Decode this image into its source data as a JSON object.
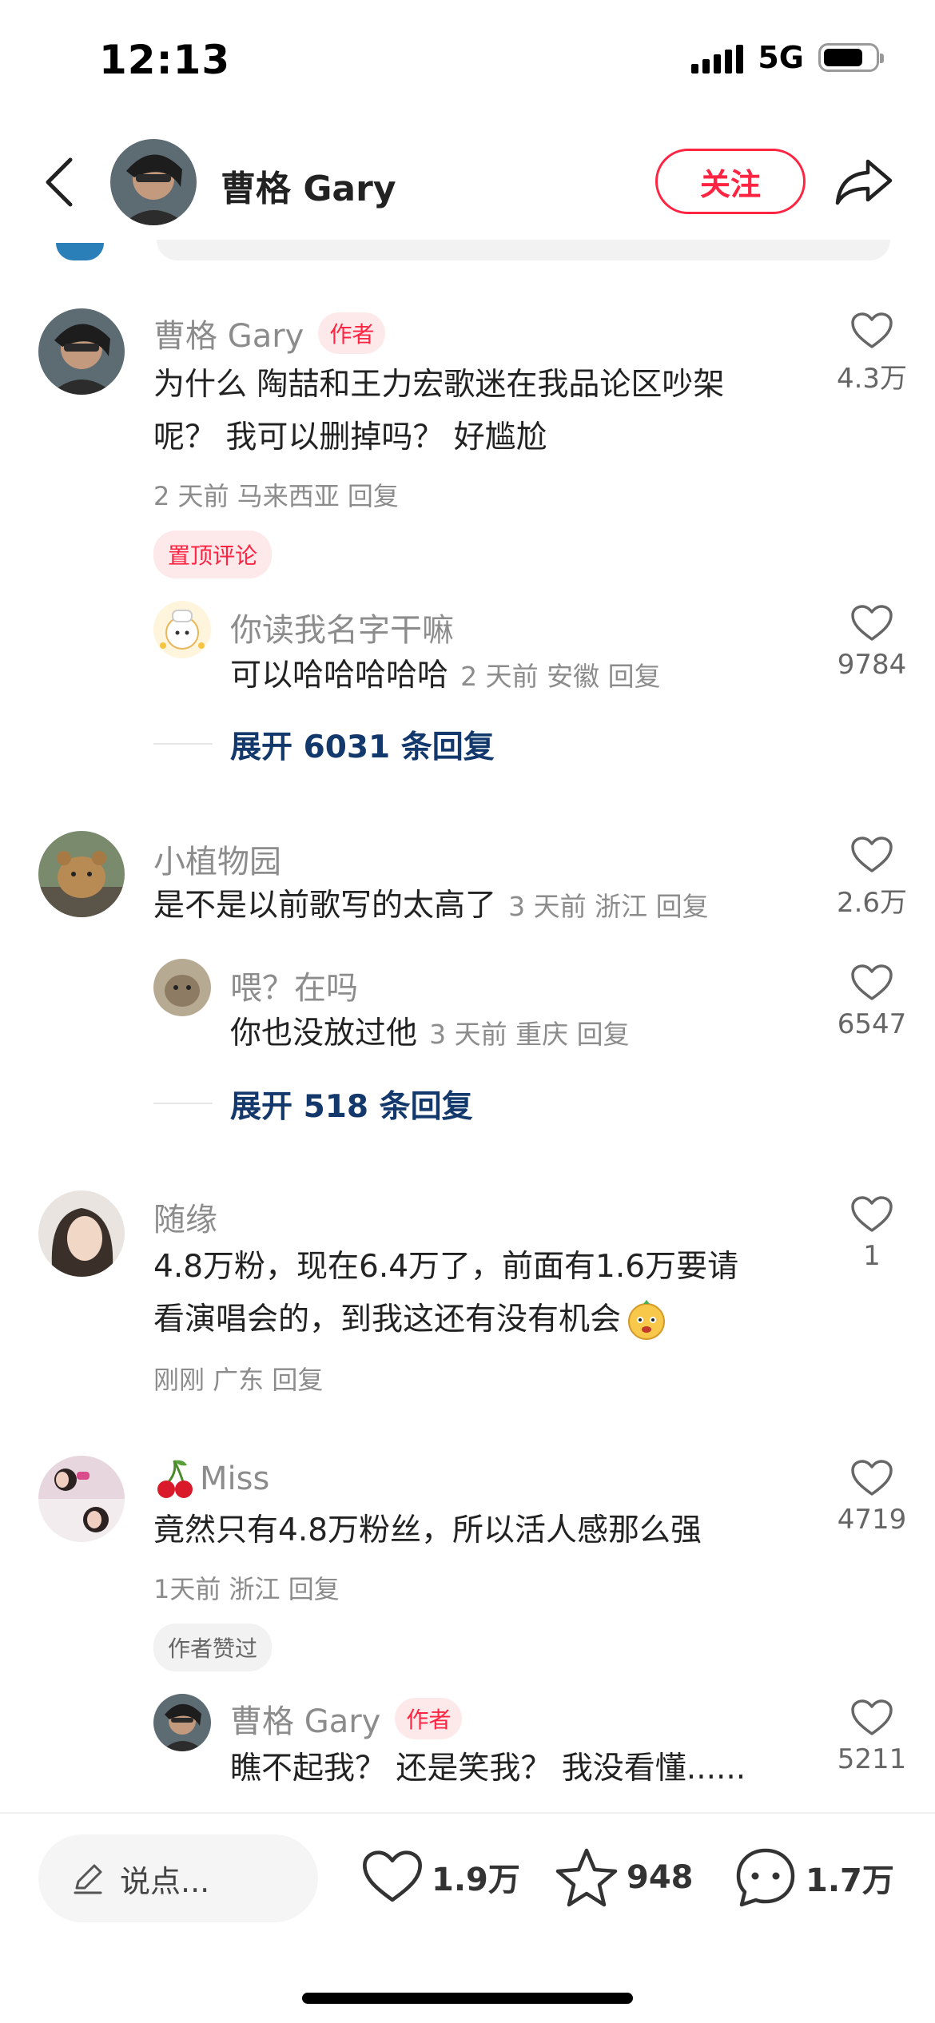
{
  "status": {
    "time": "12:13",
    "network": "5G"
  },
  "header": {
    "author_name": "曹格 Gary",
    "follow_label": "关注"
  },
  "comments": [
    {
      "user": "曹格 Gary",
      "tag": "作者",
      "text_line1": "为什么 陶喆和王力宏歌迷在我品论区吵架",
      "text_line2": "呢？ 我可以删掉吗？  好尴尬",
      "meta": "2 天前 马来西亚 回复",
      "pinned_label": "置顶评论",
      "likes": "4.3万",
      "reply": {
        "user": "你读我名字干嘛",
        "text": "可以哈哈哈哈哈",
        "meta": "2 天前 安徽 回复",
        "likes": "9784"
      },
      "expand": "展开 6031 条回复"
    },
    {
      "user": "小植物园",
      "text": "是不是以前歌写的太高了",
      "meta": "3 天前 浙江 回复",
      "likes": "2.6万",
      "reply": {
        "user": "喂？在吗",
        "text": "你也没放过他",
        "meta": "3 天前 重庆 回复",
        "likes": "6547"
      },
      "expand": "展开 518 条回复"
    },
    {
      "user": "随缘",
      "text_line1": "4.8万粉，现在6.4万了，前面有1.6万要请",
      "text_line2": "看演唱会的，到我这还有没有机会",
      "meta": "刚刚 广东 回复",
      "likes": "1"
    },
    {
      "user": "Miss",
      "text": "竟然只有4.8万粉丝，所以活人感那么强",
      "meta": "1天前 浙江 回复",
      "badge": "作者赞过",
      "likes": "4719",
      "reply": {
        "user": "曹格 Gary",
        "tag": "作者",
        "text": "瞧不起我？ 还是笑我？ 我没看懂......",
        "likes": "5211"
      }
    }
  ],
  "bottom_bar": {
    "input_placeholder": "说点...",
    "likes": "1.9万",
    "favorites": "948",
    "comments": "1.7万"
  },
  "colors": {
    "accent": "#ff2442",
    "link": "#13386c",
    "meta": "#8c8c8c"
  }
}
